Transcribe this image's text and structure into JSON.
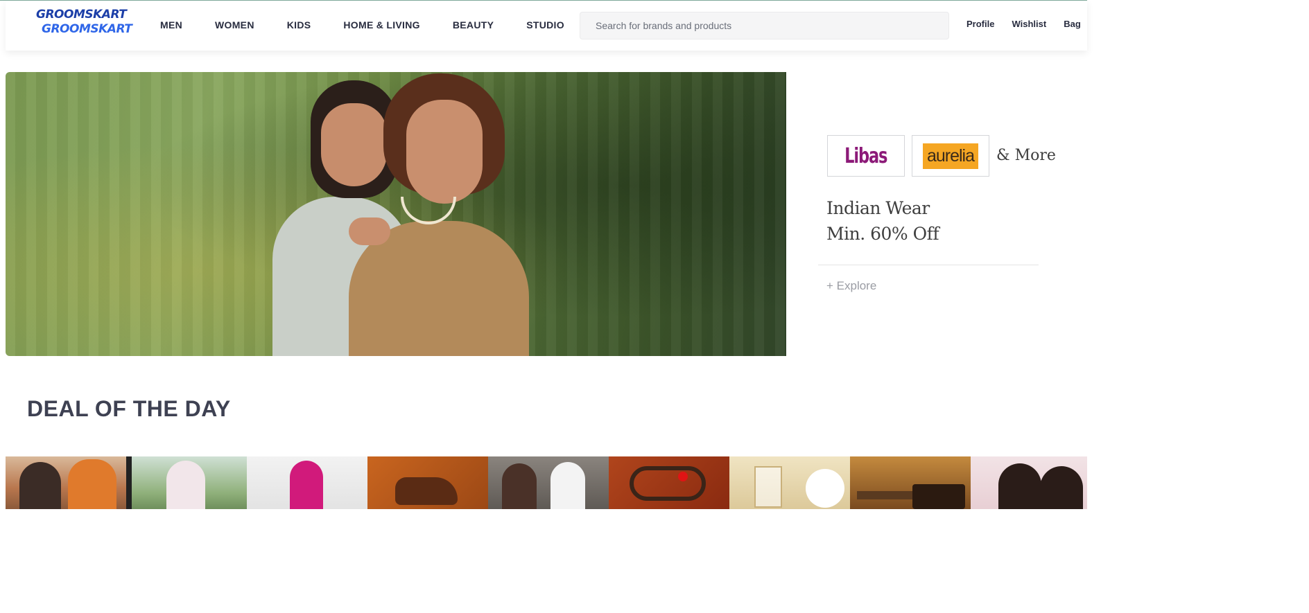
{
  "header": {
    "logo_line1": "GROOMSKART",
    "logo_line2": "GROOMSKART",
    "nav": [
      "MEN",
      "WOMEN",
      "KIDS",
      "HOME & LIVING",
      "BEAUTY",
      "STUDIO"
    ],
    "search_placeholder": "Search for brands and products",
    "actions": [
      "Profile",
      "Wishlist",
      "Bag"
    ]
  },
  "hero_promo": {
    "brand1": "Libas",
    "brand2": "aurelia",
    "more": "& More",
    "title_line1": "Indian Wear",
    "title_line2": "Min. 60% Off",
    "cta": "+ Explore"
  },
  "deal_section": {
    "title": "DEAL OF THE DAY"
  },
  "colors": {
    "logo_dark": "#1c3fa8",
    "logo_light": "#2f66e8",
    "libas": "#8c1a78",
    "aurelia_bg": "#f5a623",
    "text_primary": "#282c3f"
  }
}
